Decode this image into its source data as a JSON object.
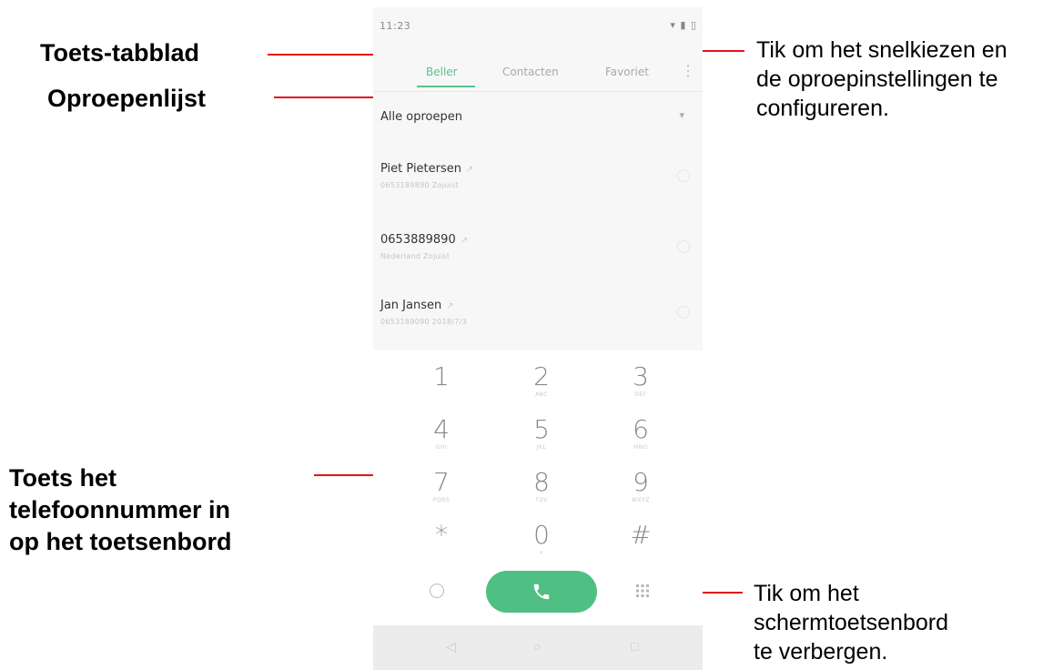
{
  "annotations": {
    "tab_label": "Toets-tabblad",
    "calllog_label": "Oproepenlijst",
    "keypad_label_lines": [
      "Toets het",
      "telefoonnummer in",
      "op het toetsenbord"
    ],
    "menu_note_lines": [
      "Tik om het snelkiezen en",
      "de oproepinstellingen te",
      "configureren."
    ],
    "hide_keypad_note_lines": [
      "Tik om het",
      "schermtoetsenbord",
      "te verbergen."
    ]
  },
  "status_bar": {
    "time": "11:23",
    "icons": "▾ ▮ ▯"
  },
  "tabs": [
    {
      "label": "Beller",
      "active": true
    },
    {
      "label": "Contacten",
      "active": false
    },
    {
      "label": "Favoriet",
      "active": false
    }
  ],
  "filter": {
    "label": "Alle oproepen"
  },
  "call_log": [
    {
      "name": "Piet Pietersen",
      "detail": "0653189890 Zojuist"
    },
    {
      "name": "0653889890",
      "detail": "Nederland Zojuist"
    },
    {
      "name": "Jan Jansen",
      "detail": "0653189090 2018/7/3"
    }
  ],
  "keypad": [
    {
      "digit": "1",
      "letters": ""
    },
    {
      "digit": "2",
      "letters": "ABC"
    },
    {
      "digit": "3",
      "letters": "DEF"
    },
    {
      "digit": "4",
      "letters": "GHI"
    },
    {
      "digit": "5",
      "letters": "JKL"
    },
    {
      "digit": "6",
      "letters": "MNO"
    },
    {
      "digit": "7",
      "letters": "PQRS"
    },
    {
      "digit": "8",
      "letters": "TUV"
    },
    {
      "digit": "9",
      "letters": "WXYZ"
    },
    {
      "digit": "*",
      "letters": ""
    },
    {
      "digit": "0",
      "letters": "+"
    },
    {
      "digit": "#",
      "letters": ""
    }
  ],
  "colors": {
    "accent": "#5cc18f",
    "call_button": "#4fbf84",
    "leader_line": "#e0141b"
  },
  "icons": {
    "more": "more-vert-icon",
    "emoji": "emoji-icon",
    "call": "phone-icon",
    "hide_keypad": "dialpad-grid-icon",
    "back": "back-triangle-icon",
    "home": "home-circle-icon",
    "recents": "recents-square-icon"
  }
}
